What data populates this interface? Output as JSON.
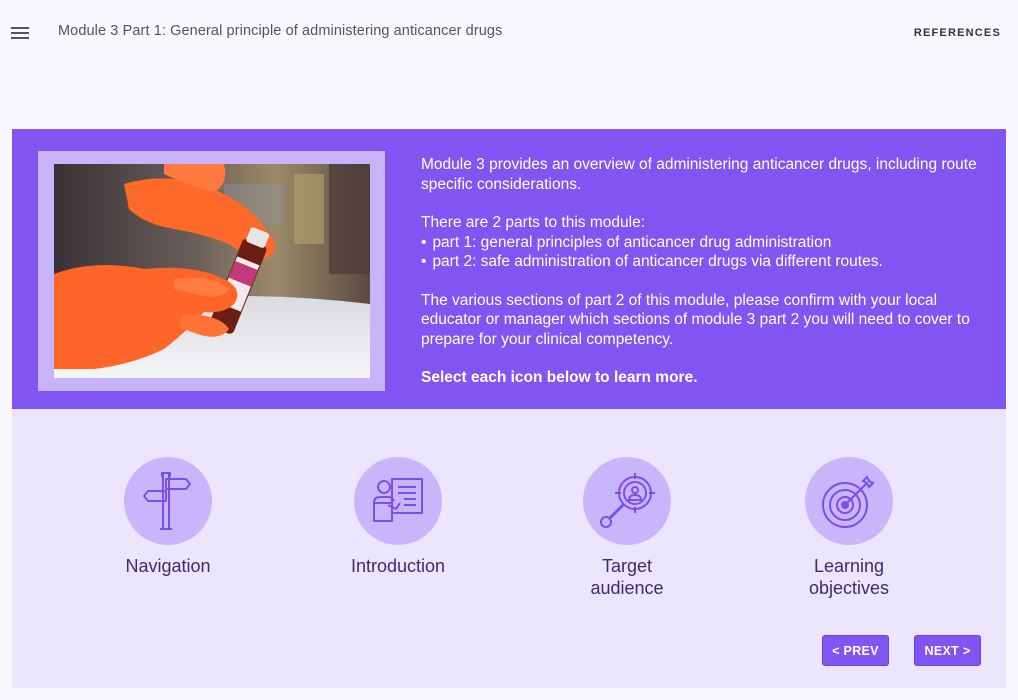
{
  "header": {
    "title": "Module 3 Part 1: General principle of administering anticancer drugs",
    "references_label": "REFERENCES"
  },
  "hero": {
    "paragraph1": "Module 3 provides an overview of administering anticancer drugs, including route specific considerations.",
    "paragraph2_lead": "There are 2 parts to this module:",
    "parts": [
      "part 1: general principles of anticancer drug administration",
      "part 2: safe administration of anticancer drugs via different routes."
    ],
    "paragraph3": "The various sections of part 2 of this module, please confirm with your local educator or manager which sections of module 3 part 2 you will need to cover to prepare for your clinical competency.",
    "cta": "Select each icon below to learn more."
  },
  "cards": [
    {
      "label_line1": "Navigation",
      "label_line2": "",
      "icon": "signpost-icon"
    },
    {
      "label_line1": "Introduction",
      "label_line2": "",
      "icon": "presentation-icon"
    },
    {
      "label_line1": "Target",
      "label_line2": "audience",
      "icon": "target-person-icon"
    },
    {
      "label_line1": "Learning",
      "label_line2": "objectives",
      "icon": "bullseye-arrow-icon"
    }
  ],
  "nav": {
    "prev_label": "< PREV",
    "next_label": "NEXT >"
  },
  "colors": {
    "accent": "#8155f2",
    "frame": "#c7b4fb",
    "lower_bg": "#ebe5fd",
    "icon_circle": "#c8b5fb",
    "icon_stroke": "#7b4fe8"
  }
}
